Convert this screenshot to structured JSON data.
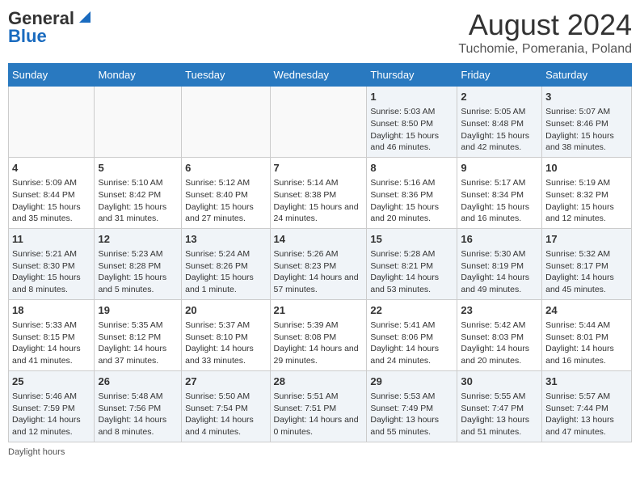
{
  "logo": {
    "part1": "General",
    "part2": "Blue"
  },
  "title": "August 2024",
  "subtitle": "Tuchomie, Pomerania, Poland",
  "headers": [
    "Sunday",
    "Monday",
    "Tuesday",
    "Wednesday",
    "Thursday",
    "Friday",
    "Saturday"
  ],
  "weeks": [
    [
      {
        "day": "",
        "content": ""
      },
      {
        "day": "",
        "content": ""
      },
      {
        "day": "",
        "content": ""
      },
      {
        "day": "",
        "content": ""
      },
      {
        "day": "1",
        "content": "Sunrise: 5:03 AM\nSunset: 8:50 PM\nDaylight: 15 hours and 46 minutes."
      },
      {
        "day": "2",
        "content": "Sunrise: 5:05 AM\nSunset: 8:48 PM\nDaylight: 15 hours and 42 minutes."
      },
      {
        "day": "3",
        "content": "Sunrise: 5:07 AM\nSunset: 8:46 PM\nDaylight: 15 hours and 38 minutes."
      }
    ],
    [
      {
        "day": "4",
        "content": "Sunrise: 5:09 AM\nSunset: 8:44 PM\nDaylight: 15 hours and 35 minutes."
      },
      {
        "day": "5",
        "content": "Sunrise: 5:10 AM\nSunset: 8:42 PM\nDaylight: 15 hours and 31 minutes."
      },
      {
        "day": "6",
        "content": "Sunrise: 5:12 AM\nSunset: 8:40 PM\nDaylight: 15 hours and 27 minutes."
      },
      {
        "day": "7",
        "content": "Sunrise: 5:14 AM\nSunset: 8:38 PM\nDaylight: 15 hours and 24 minutes."
      },
      {
        "day": "8",
        "content": "Sunrise: 5:16 AM\nSunset: 8:36 PM\nDaylight: 15 hours and 20 minutes."
      },
      {
        "day": "9",
        "content": "Sunrise: 5:17 AM\nSunset: 8:34 PM\nDaylight: 15 hours and 16 minutes."
      },
      {
        "day": "10",
        "content": "Sunrise: 5:19 AM\nSunset: 8:32 PM\nDaylight: 15 hours and 12 minutes."
      }
    ],
    [
      {
        "day": "11",
        "content": "Sunrise: 5:21 AM\nSunset: 8:30 PM\nDaylight: 15 hours and 8 minutes."
      },
      {
        "day": "12",
        "content": "Sunrise: 5:23 AM\nSunset: 8:28 PM\nDaylight: 15 hours and 5 minutes."
      },
      {
        "day": "13",
        "content": "Sunrise: 5:24 AM\nSunset: 8:26 PM\nDaylight: 15 hours and 1 minute."
      },
      {
        "day": "14",
        "content": "Sunrise: 5:26 AM\nSunset: 8:23 PM\nDaylight: 14 hours and 57 minutes."
      },
      {
        "day": "15",
        "content": "Sunrise: 5:28 AM\nSunset: 8:21 PM\nDaylight: 14 hours and 53 minutes."
      },
      {
        "day": "16",
        "content": "Sunrise: 5:30 AM\nSunset: 8:19 PM\nDaylight: 14 hours and 49 minutes."
      },
      {
        "day": "17",
        "content": "Sunrise: 5:32 AM\nSunset: 8:17 PM\nDaylight: 14 hours and 45 minutes."
      }
    ],
    [
      {
        "day": "18",
        "content": "Sunrise: 5:33 AM\nSunset: 8:15 PM\nDaylight: 14 hours and 41 minutes."
      },
      {
        "day": "19",
        "content": "Sunrise: 5:35 AM\nSunset: 8:12 PM\nDaylight: 14 hours and 37 minutes."
      },
      {
        "day": "20",
        "content": "Sunrise: 5:37 AM\nSunset: 8:10 PM\nDaylight: 14 hours and 33 minutes."
      },
      {
        "day": "21",
        "content": "Sunrise: 5:39 AM\nSunset: 8:08 PM\nDaylight: 14 hours and 29 minutes."
      },
      {
        "day": "22",
        "content": "Sunrise: 5:41 AM\nSunset: 8:06 PM\nDaylight: 14 hours and 24 minutes."
      },
      {
        "day": "23",
        "content": "Sunrise: 5:42 AM\nSunset: 8:03 PM\nDaylight: 14 hours and 20 minutes."
      },
      {
        "day": "24",
        "content": "Sunrise: 5:44 AM\nSunset: 8:01 PM\nDaylight: 14 hours and 16 minutes."
      }
    ],
    [
      {
        "day": "25",
        "content": "Sunrise: 5:46 AM\nSunset: 7:59 PM\nDaylight: 14 hours and 12 minutes."
      },
      {
        "day": "26",
        "content": "Sunrise: 5:48 AM\nSunset: 7:56 PM\nDaylight: 14 hours and 8 minutes."
      },
      {
        "day": "27",
        "content": "Sunrise: 5:50 AM\nSunset: 7:54 PM\nDaylight: 14 hours and 4 minutes."
      },
      {
        "day": "28",
        "content": "Sunrise: 5:51 AM\nSunset: 7:51 PM\nDaylight: 14 hours and 0 minutes."
      },
      {
        "day": "29",
        "content": "Sunrise: 5:53 AM\nSunset: 7:49 PM\nDaylight: 13 hours and 55 minutes."
      },
      {
        "day": "30",
        "content": "Sunrise: 5:55 AM\nSunset: 7:47 PM\nDaylight: 13 hours and 51 minutes."
      },
      {
        "day": "31",
        "content": "Sunrise: 5:57 AM\nSunset: 7:44 PM\nDaylight: 13 hours and 47 minutes."
      }
    ]
  ],
  "footer": {
    "daylight_label": "Daylight hours"
  }
}
